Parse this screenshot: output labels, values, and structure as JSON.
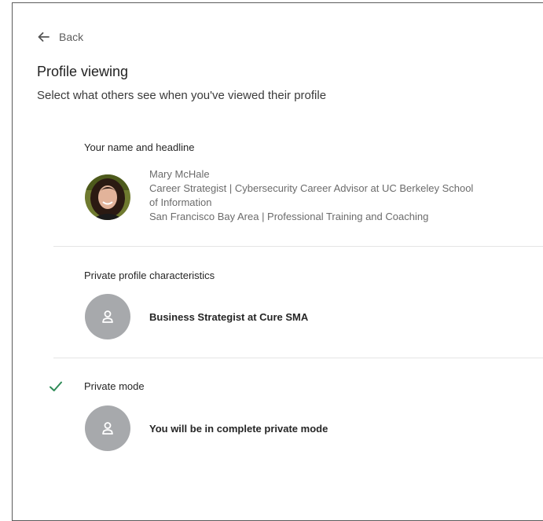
{
  "nav": {
    "back_label": "Back"
  },
  "page": {
    "title": "Profile viewing",
    "subtitle": "Select what others see when you've viewed their profile"
  },
  "options": {
    "name_headline": {
      "heading": "Your name and headline",
      "lines": [
        "Mary McHale",
        "Career Strategist | Cybersecurity Career Advisor at UC Berkeley School",
        "of Information",
        "San Francisco Bay Area | Professional Training and Coaching"
      ],
      "selected": false
    },
    "private_characteristics": {
      "heading": "Private profile characteristics",
      "text": "Business Strategist at Cure SMA",
      "selected": false
    },
    "private_mode": {
      "heading": "Private mode",
      "text": "You will be in complete private mode",
      "selected": true
    }
  },
  "icons": {
    "back": "arrow-left-icon",
    "check": "checkmark-icon",
    "placeholder_avatar": "person-outline-icon"
  },
  "colors": {
    "check": "#2e8b57",
    "placeholder_avatar": "#a7a9ac",
    "divider": "#e4e4e4",
    "frame_border": "#5b5b5b"
  }
}
